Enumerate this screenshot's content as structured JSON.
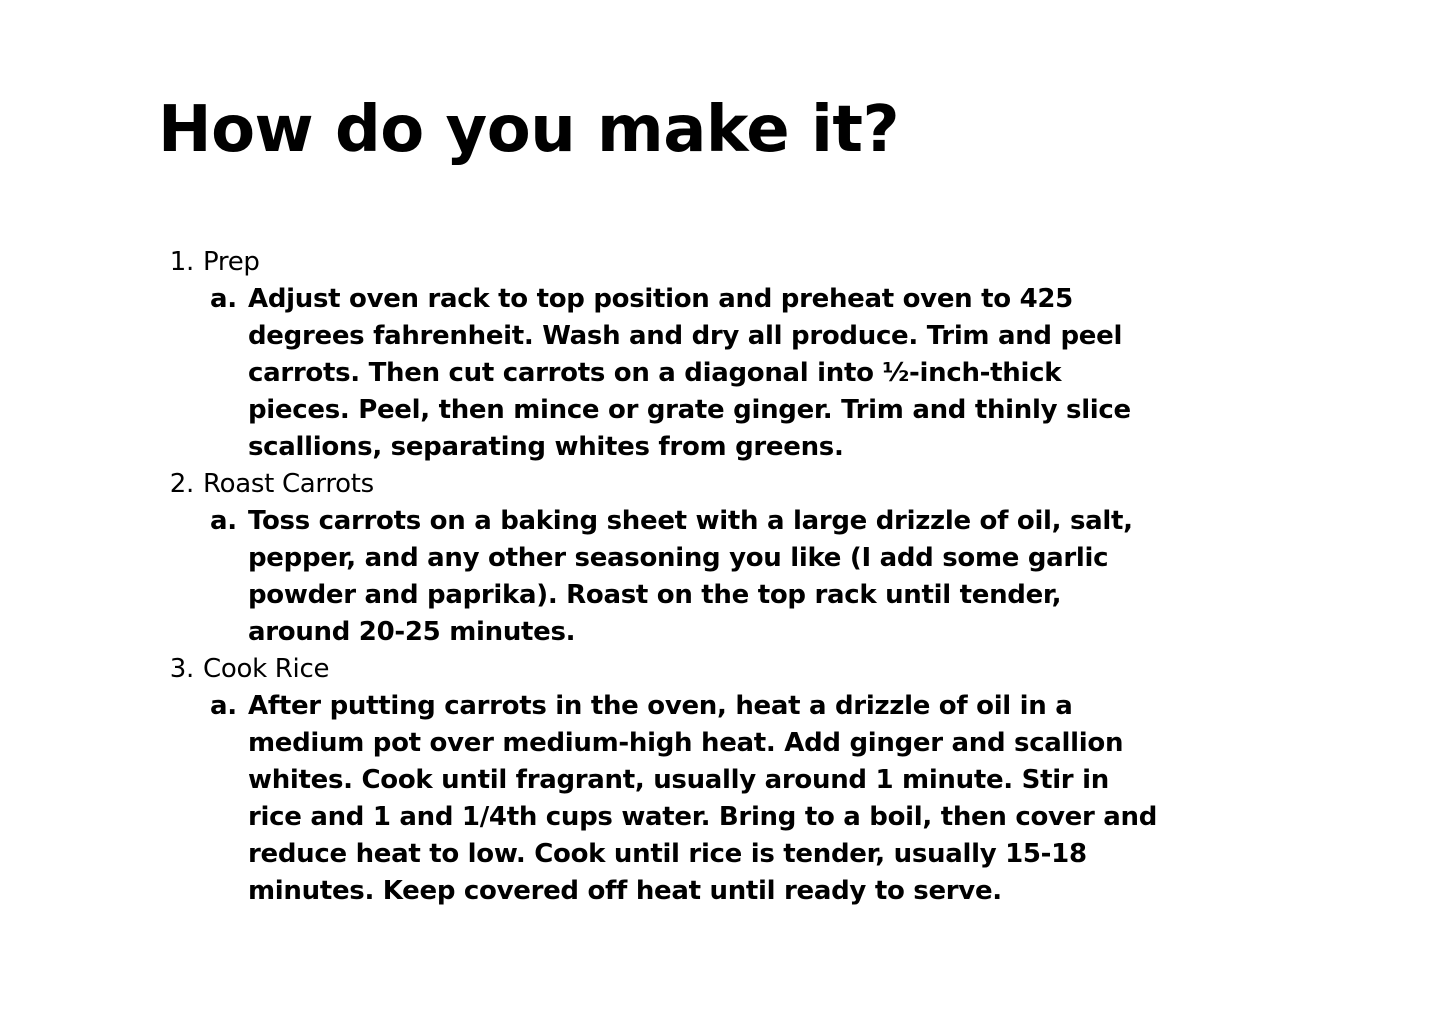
{
  "page": {
    "title": "How do you make it?"
  },
  "steps": [
    {
      "number": "1.",
      "title": "Prep",
      "substep_letter": "a.",
      "substep_text": "Adjust oven rack to top position and preheat oven to 425 degrees fahrenheit. Wash and dry all produce. Trim and peel carrots. Then cut carrots on a diagonal into ½-inch-thick pieces. Peel, then mince or grate ginger. Trim and thinly slice scallions, separating whites from greens."
    },
    {
      "number": "2.",
      "title": "Roast Carrots",
      "substep_letter": "a.",
      "substep_text": "Toss carrots on a baking sheet with a large drizzle of oil, salt, pepper, and any other seasoning you like (I add some garlic powder and paprika). Roast on the top rack until tender, around 20-25 minutes."
    },
    {
      "number": "3.",
      "title": "Cook Rice",
      "substep_letter": "a.",
      "substep_text": "After putting carrots in the oven, heat a drizzle of oil in a medium pot over medium-high heat. Add ginger and scallion whites. Cook until fragrant, usually around 1 minute. Stir in rice and 1 and 1/4th cups water. Bring to a boil, then cover and reduce heat to low. Cook until rice is tender, usually 15-18 minutes. Keep covered off heat until ready to serve."
    }
  ]
}
